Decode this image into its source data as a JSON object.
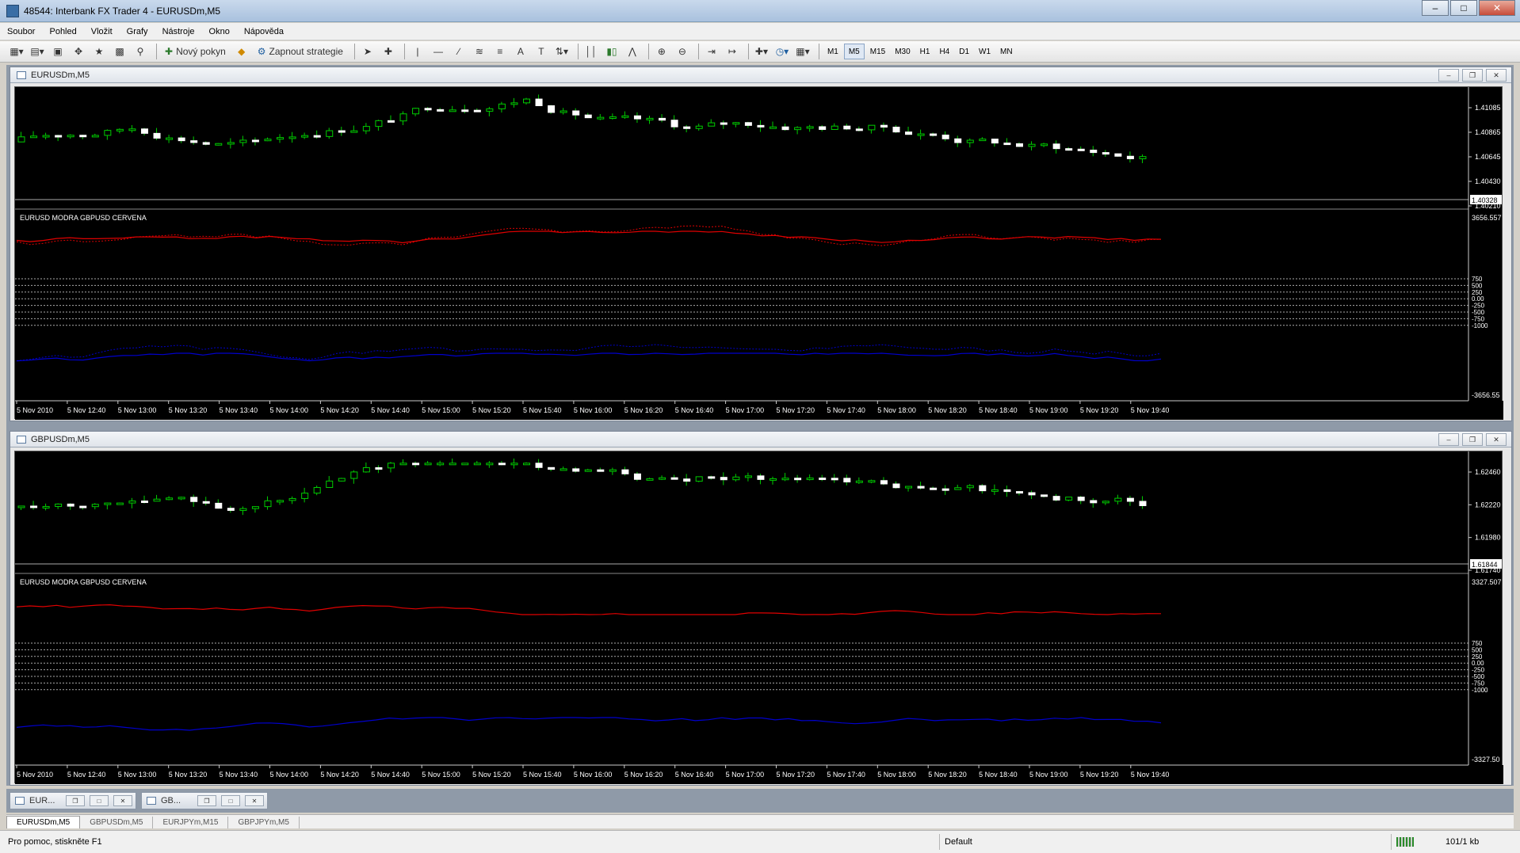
{
  "window": {
    "title": "48544: Interbank FX Trader 4 - EURUSDm,M5"
  },
  "menu": [
    "Soubor",
    "Pohled",
    "Vložit",
    "Grafy",
    "Nástroje",
    "Okno",
    "Nápověda"
  ],
  "toolbar": {
    "new_order_label": "Nový pokyn",
    "strategies_label": "Zapnout strategie",
    "timeframes": [
      "M1",
      "M5",
      "M15",
      "M30",
      "H1",
      "H4",
      "D1",
      "W1",
      "MN"
    ],
    "active_timeframe": "M5"
  },
  "charts": [
    {
      "title": "EURUSDm,M5",
      "price_axis": [
        "1.41085",
        "1.40865",
        "1.40645",
        "1.40430",
        "1.40210"
      ],
      "current_price": "1.40328",
      "indicator_label": "EURUSD MODRA    GBPUSD CERVENA",
      "indicator_top": "3656.557",
      "indicator_bottom": "-3656.55",
      "levels": [
        "750",
        "500",
        "250",
        "0.00",
        "-250",
        "-500",
        "-750",
        "-1000"
      ],
      "time_axis": [
        "5 Nov 2010",
        "5 Nov 12:40",
        "5 Nov 13:00",
        "5 Nov 13:20",
        "5 Nov 13:40",
        "5 Nov 14:00",
        "5 Nov 14:20",
        "5 Nov 14:40",
        "5 Nov 15:00",
        "5 Nov 15:20",
        "5 Nov 15:40",
        "5 Nov 16:00",
        "5 Nov 16:20",
        "5 Nov 16:40",
        "5 Nov 17:00",
        "5 Nov 17:20",
        "5 Nov 17:40",
        "5 Nov 18:00",
        "5 Nov 18:20",
        "5 Nov 18:40",
        "5 Nov 19:00",
        "5 Nov 19:20",
        "5 Nov 19:40"
      ]
    },
    {
      "title": "GBPUSDm,M5",
      "price_axis": [
        "1.62460",
        "1.62220",
        "1.61980",
        "1.61740"
      ],
      "current_price": "1.61844",
      "indicator_label": "EURUSD MODRA    GBPUSD CERVENA",
      "indicator_top": "3327.507",
      "indicator_bottom": "-3327.50",
      "levels": [
        "750",
        "500",
        "250",
        "0.00",
        "-250",
        "-500",
        "-750",
        "-1000"
      ],
      "time_axis": [
        "5 Nov 2010",
        "5 Nov 12:40",
        "5 Nov 13:00",
        "5 Nov 13:20",
        "5 Nov 13:40",
        "5 Nov 14:00",
        "5 Nov 14:20",
        "5 Nov 14:40",
        "5 Nov 15:00",
        "5 Nov 15:20",
        "5 Nov 15:40",
        "5 Nov 16:00",
        "5 Nov 16:20",
        "5 Nov 16:40",
        "5 Nov 17:00",
        "5 Nov 17:20",
        "5 Nov 17:40",
        "5 Nov 18:00",
        "5 Nov 18:20",
        "5 Nov 18:40",
        "5 Nov 19:00",
        "5 Nov 19:20",
        "5 Nov 19:40"
      ]
    }
  ],
  "minimized_windows": [
    "EUR...",
    "GB..."
  ],
  "chart_tabs": [
    "EURUSDm,M5",
    "GBPUSDm,M5",
    "EURJPYm,M15",
    "GBPJPYm,M5"
  ],
  "status": {
    "help": "Pro pomoc, stiskněte F1",
    "profile": "Default",
    "traffic": "101/1 kb"
  },
  "colors": {
    "bull": "#00cc00",
    "bear": "#ffffff",
    "red_line": "#e00000",
    "blue_line": "#0000cc",
    "background": "#000000"
  }
}
